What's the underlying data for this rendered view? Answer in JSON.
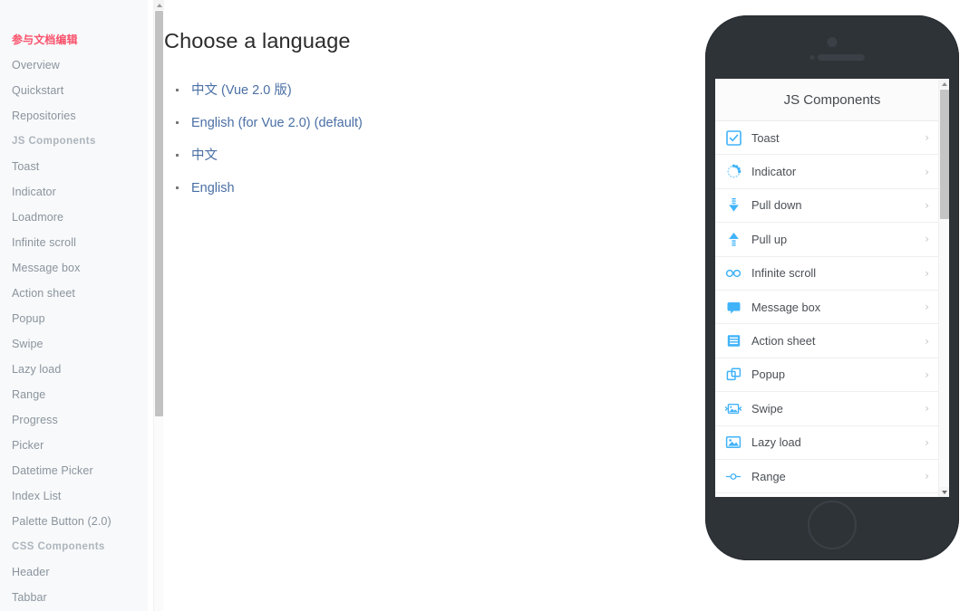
{
  "colors": {
    "accent_blue": "#41b3f9",
    "link_blue": "#4a6fa5",
    "highlight_red": "#f9526c",
    "sidebar_bg": "#f8f9fa",
    "phone_body": "#2e3338",
    "text_dark": "#2b2b2b"
  },
  "sidebar": {
    "items": [
      {
        "label": "参与文档编辑",
        "style": "highlight"
      },
      {
        "label": "Overview",
        "style": "plain"
      },
      {
        "label": "Quickstart",
        "style": "plain"
      },
      {
        "label": "Repositories",
        "style": "plain"
      },
      {
        "label": "JS Components",
        "style": "section"
      },
      {
        "label": "Toast",
        "style": "plain"
      },
      {
        "label": "Indicator",
        "style": "plain"
      },
      {
        "label": "Loadmore",
        "style": "plain"
      },
      {
        "label": "Infinite scroll",
        "style": "plain"
      },
      {
        "label": "Message box",
        "style": "plain"
      },
      {
        "label": "Action sheet",
        "style": "plain"
      },
      {
        "label": "Popup",
        "style": "plain"
      },
      {
        "label": "Swipe",
        "style": "plain"
      },
      {
        "label": "Lazy load",
        "style": "plain"
      },
      {
        "label": "Range",
        "style": "plain"
      },
      {
        "label": "Progress",
        "style": "plain"
      },
      {
        "label": "Picker",
        "style": "plain"
      },
      {
        "label": "Datetime Picker",
        "style": "plain"
      },
      {
        "label": "Index List",
        "style": "plain"
      },
      {
        "label": "Palette Button (2.0)",
        "style": "plain"
      },
      {
        "label": "CSS Components",
        "style": "section"
      },
      {
        "label": "Header",
        "style": "plain"
      },
      {
        "label": "Tabbar",
        "style": "plain"
      }
    ]
  },
  "main": {
    "title": "Choose a language",
    "languages": [
      {
        "link": "中文",
        "suffix": "  (Vue 2.0 版)"
      },
      {
        "link": "English (for Vue 2.0) (default)",
        "suffix": ""
      },
      {
        "link": "中文",
        "suffix": ""
      },
      {
        "link": "English",
        "suffix": ""
      }
    ]
  },
  "phone": {
    "screen_title": "JS Components",
    "chevron": "›",
    "components": [
      {
        "label": "Toast",
        "icon": "checkbox-icon"
      },
      {
        "label": "Indicator",
        "icon": "spinner-icon"
      },
      {
        "label": "Pull down",
        "icon": "arrow-down-icon"
      },
      {
        "label": "Pull up",
        "icon": "arrow-up-icon"
      },
      {
        "label": "Infinite scroll",
        "icon": "infinity-icon"
      },
      {
        "label": "Message box",
        "icon": "speech-bubble-icon"
      },
      {
        "label": "Action sheet",
        "icon": "list-sheet-icon"
      },
      {
        "label": "Popup",
        "icon": "windows-stack-icon"
      },
      {
        "label": "Swipe",
        "icon": "carousel-image-icon"
      },
      {
        "label": "Lazy load",
        "icon": "image-placeholder-icon"
      },
      {
        "label": "Range",
        "icon": "slider-range-icon"
      }
    ]
  }
}
